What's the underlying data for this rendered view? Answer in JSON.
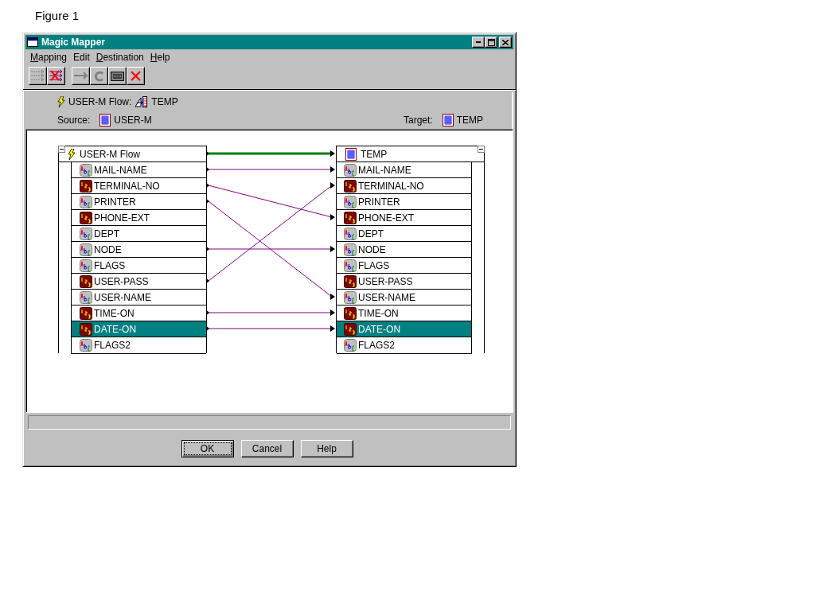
{
  "figure_caption": "Figure 1",
  "window": {
    "title": "Magic Mapper"
  },
  "menu": [
    {
      "label": "Mapping",
      "mnemonic": true
    },
    {
      "label": "Edit",
      "mnemonic": false
    },
    {
      "label": "Destination",
      "mnemonic": true
    },
    {
      "label": "Help",
      "mnemonic": true
    }
  ],
  "toolbar": [
    [
      {
        "kind": "map-all",
        "disabled": true
      },
      {
        "kind": "unmap-all",
        "disabled": false
      }
    ],
    [
      {
        "kind": "map",
        "disabled": true
      },
      {
        "kind": "compute",
        "disabled": true
      },
      {
        "kind": "field",
        "disabled": false
      },
      {
        "kind": "delete",
        "disabled": false
      }
    ]
  ],
  "flow": {
    "name": "USER-M Flow:",
    "target": "TEMP"
  },
  "source": {
    "label": "Source:",
    "name": "USER-M"
  },
  "target": {
    "label": "Target:",
    "name": "TEMP"
  },
  "source_table": {
    "title": "USER-M Flow",
    "linked": true,
    "fields": [
      {
        "label": "MAIL-NAME",
        "kind": "text",
        "selected": false,
        "links": {
          "row_a": true
        }
      },
      {
        "label": "TERMINAL-NO",
        "kind": "number",
        "selected": false,
        "links": {
          "row_d": true
        }
      },
      {
        "label": "PRINTER",
        "kind": "text",
        "selected": false,
        "links": {
          "row_i": true
        }
      },
      {
        "label": "PHONE-EXT",
        "kind": "number",
        "selected": false
      },
      {
        "label": "DEPT",
        "kind": "text",
        "selected": false
      },
      {
        "label": "NODE",
        "kind": "text",
        "selected": false,
        "links": {
          "row_f": true
        }
      },
      {
        "label": "FLAGS",
        "kind": "text",
        "selected": false
      },
      {
        "label": "USER-PASS",
        "kind": "number",
        "selected": false,
        "links": {
          "row_b": true
        }
      },
      {
        "label": "USER-NAME",
        "kind": "text",
        "selected": false
      },
      {
        "label": "TIME-ON",
        "kind": "number",
        "selected": false,
        "links": {
          "row_j": true
        }
      },
      {
        "label": "DATE-ON",
        "kind": "number",
        "selected": true,
        "links": {
          "row_k": true
        }
      },
      {
        "label": "FLAGS2",
        "kind": "text",
        "selected": false
      }
    ]
  },
  "target_table": {
    "title": "TEMP",
    "fields": [
      {
        "label": "MAIL-NAME",
        "kind": "text",
        "selected": false
      },
      {
        "label": "TERMINAL-NO",
        "kind": "number",
        "selected": false
      },
      {
        "label": "PRINTER",
        "kind": "text",
        "selected": false
      },
      {
        "label": "PHONE-EXT",
        "kind": "number",
        "selected": false
      },
      {
        "label": "DEPT",
        "kind": "text",
        "selected": false
      },
      {
        "label": "NODE",
        "kind": "text",
        "selected": false
      },
      {
        "label": "FLAGS",
        "kind": "text",
        "selected": false
      },
      {
        "label": "USER-PASS",
        "kind": "number",
        "selected": false
      },
      {
        "label": "USER-NAME",
        "kind": "text",
        "selected": false
      },
      {
        "label": "TIME-ON",
        "kind": "number",
        "selected": false
      },
      {
        "label": "DATE-ON",
        "kind": "number",
        "selected": true
      },
      {
        "label": "FLAGS2",
        "kind": "text",
        "selected": false
      }
    ]
  },
  "buttons": [
    {
      "label": "OK",
      "default": true
    },
    {
      "label": "Cancel",
      "default": false
    },
    {
      "label": "Help",
      "default": false
    }
  ]
}
